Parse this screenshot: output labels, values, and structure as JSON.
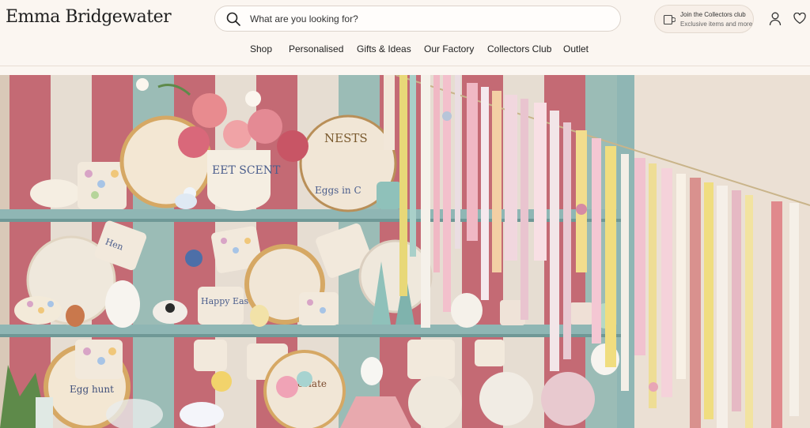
{
  "brand": {
    "name": "Emma Bridgewater"
  },
  "search": {
    "placeholder": "What are you looking for?",
    "value": ""
  },
  "collectors_club": {
    "title": "Join the Collectors club",
    "subtitle": "Exclusive items and more"
  },
  "nav": {
    "items": [
      {
        "label": "Shop"
      },
      {
        "label": "Personalised"
      },
      {
        "label": "Gifts & Ideas"
      },
      {
        "label": "Our Factory"
      },
      {
        "label": "Collectors Club"
      },
      {
        "label": "Outlet"
      }
    ]
  },
  "hero": {
    "pottery_text": {
      "sweet_scent": "EET SCENT",
      "nests": "NESTS",
      "eggs": "Eggs in C",
      "hen_mug": "Hen",
      "easter_mug": "Happy Easter",
      "egg_hunt": "Egg hunt",
      "chocolate": "Chocolate"
    }
  },
  "colors": {
    "background": "#fbf6f1",
    "stripe_pink": "#c46a74",
    "stripe_teal": "#9bbcb6",
    "shelf": "#8fb6b4"
  }
}
